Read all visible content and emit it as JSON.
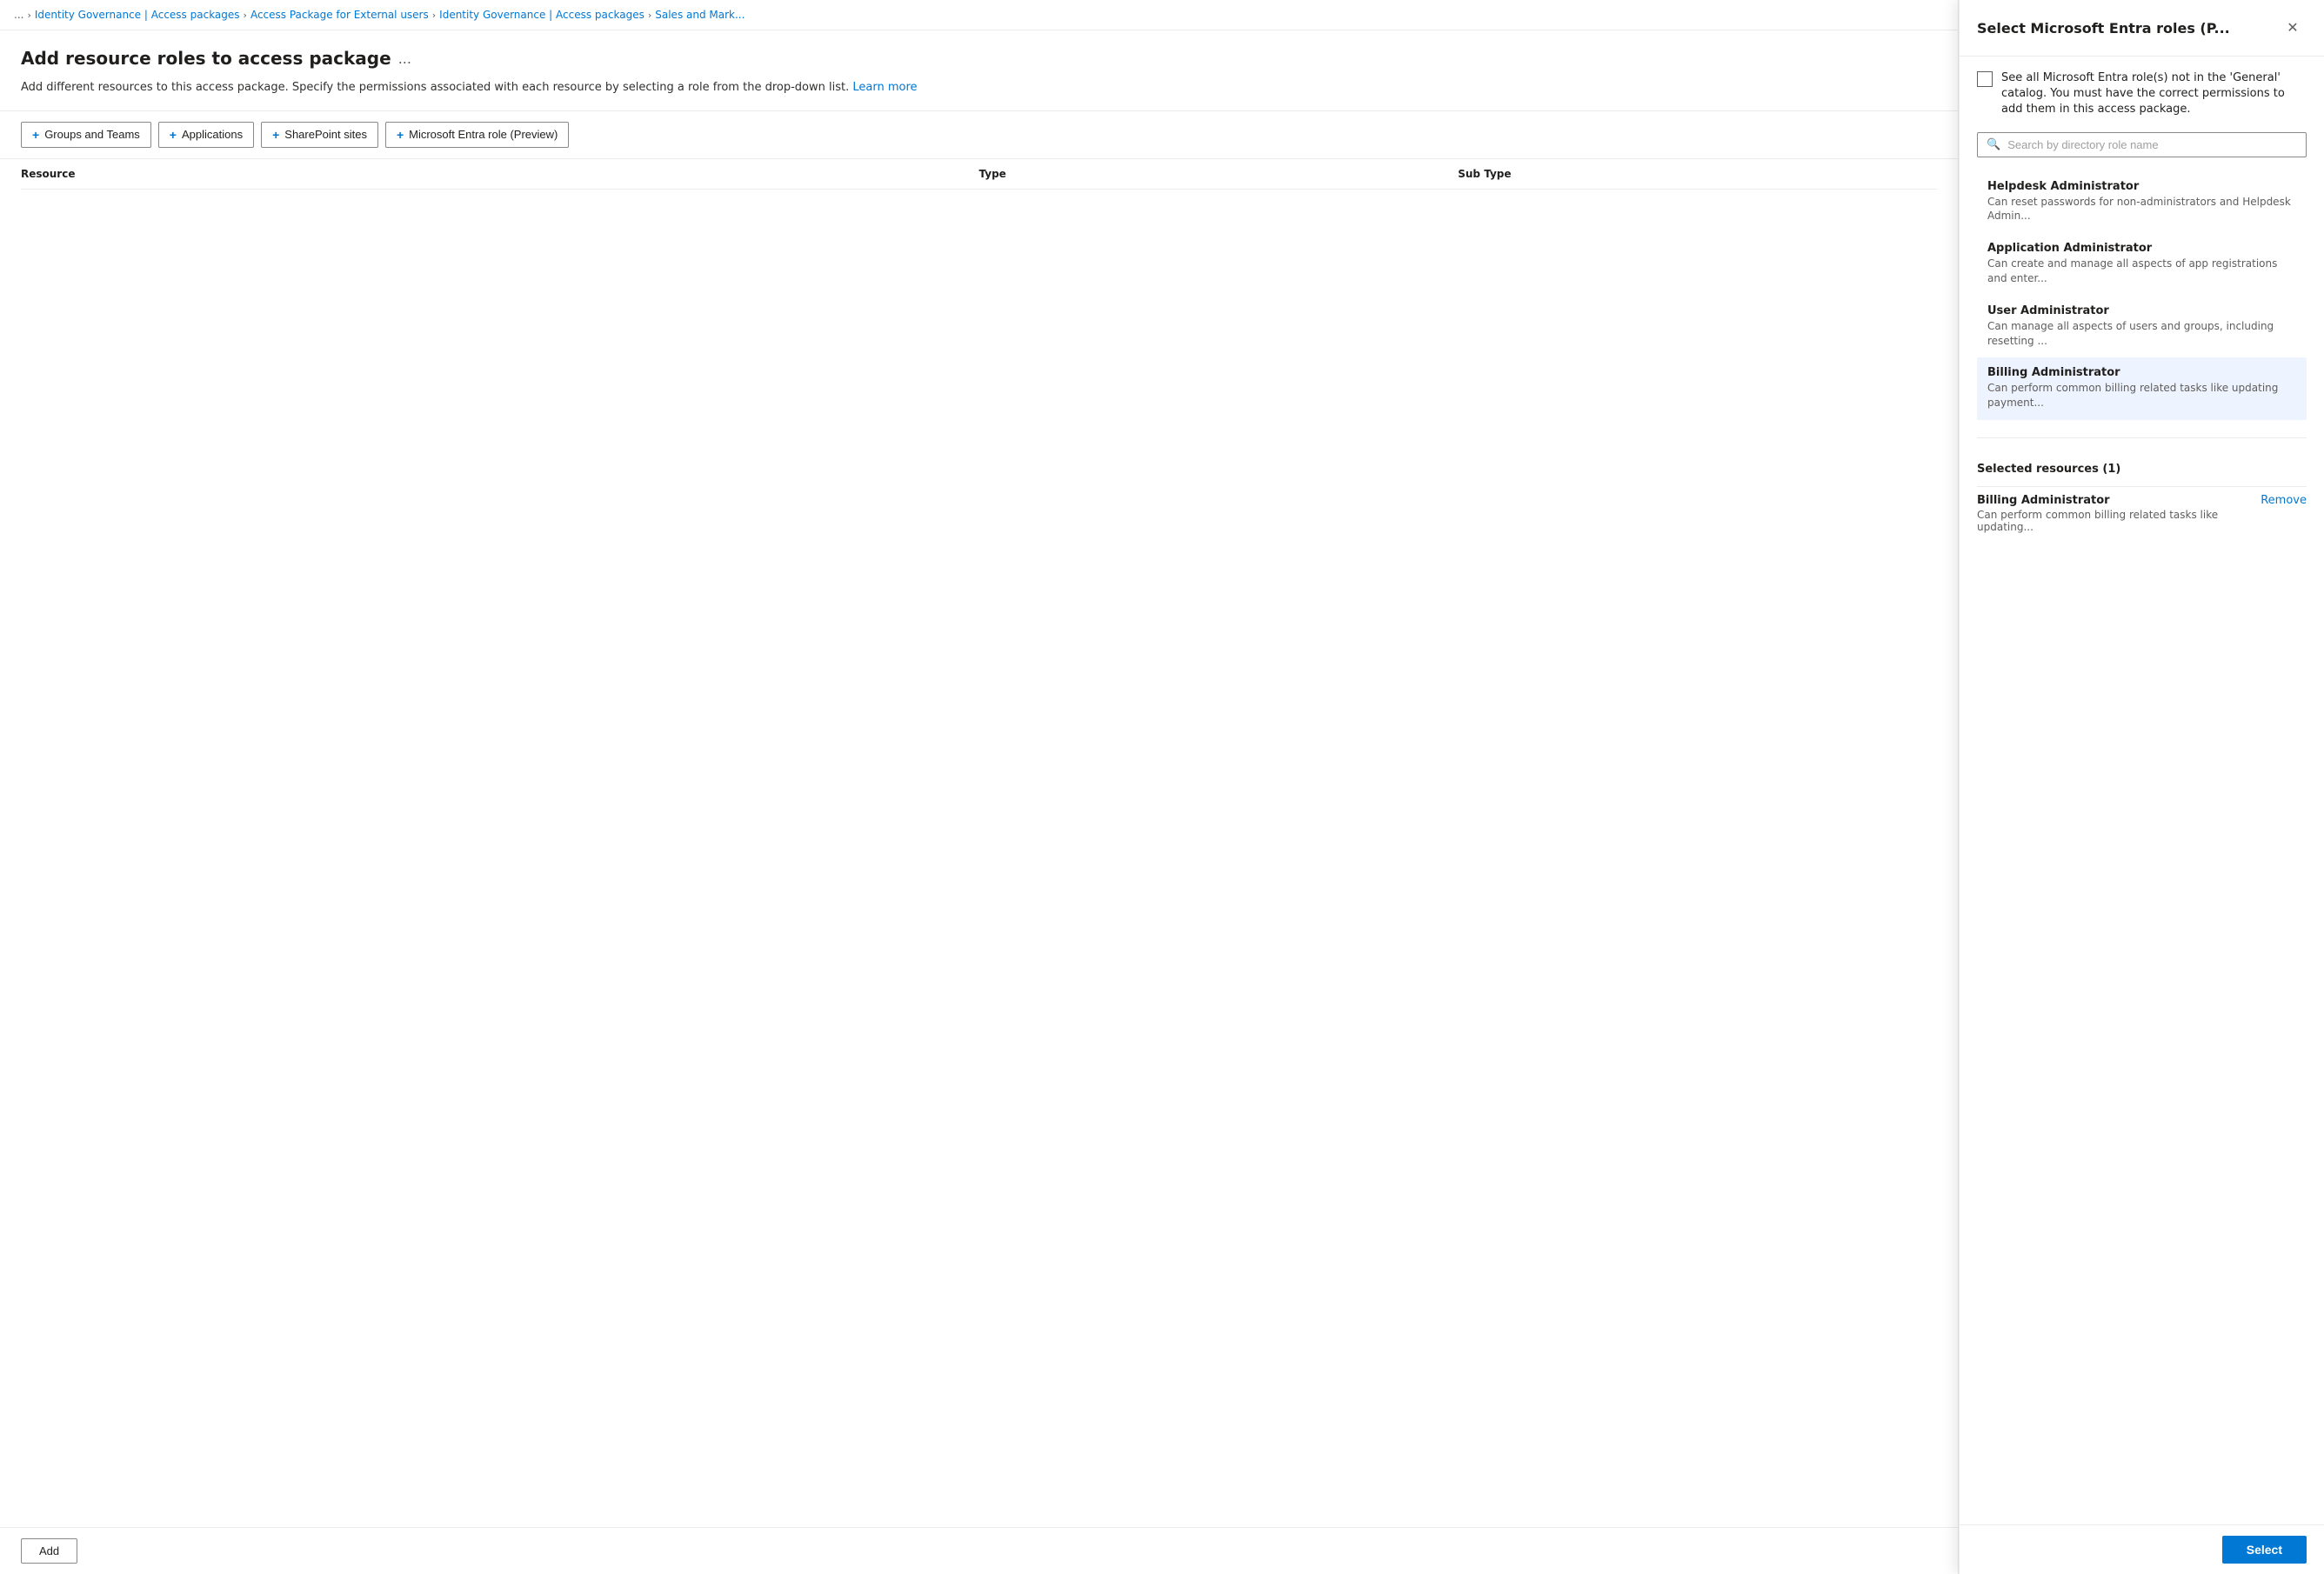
{
  "breadcrumb": {
    "dots": "...",
    "items": [
      {
        "label": "Identity Governance | Access packages"
      },
      {
        "label": "Access Package for External users"
      },
      {
        "label": "Identity Governance | Access packages"
      },
      {
        "label": "Sales and Mark..."
      }
    ]
  },
  "page": {
    "title": "Add resource roles to access package",
    "title_more": "...",
    "description": "Add different resources to this access package. Specify the permissions associated with each resource by selecting a role from the drop-down list.",
    "learn_more": "Learn more"
  },
  "toolbar": {
    "buttons": [
      {
        "label": "Groups and Teams",
        "icon": "+"
      },
      {
        "label": "Applications",
        "icon": "+"
      },
      {
        "label": "SharePoint sites",
        "icon": "+"
      },
      {
        "label": "Microsoft Entra role (Preview)",
        "icon": "+"
      }
    ]
  },
  "table": {
    "columns": [
      "Resource",
      "Type",
      "Sub Type"
    ]
  },
  "bottom": {
    "add_label": "Add"
  },
  "side_panel": {
    "title": "Select Microsoft Entra roles (P...",
    "close_icon": "✕",
    "checkbox_label": "See all Microsoft Entra role(s) not in the 'General' catalog. You must have the correct permissions to add them in this access package.",
    "search_placeholder": "Search by directory role name",
    "roles": [
      {
        "name": "Helpdesk Administrator",
        "desc": "Can reset passwords for non-administrators and Helpdesk Admin...",
        "selected": false,
        "highlighted": false
      },
      {
        "name": "Application Administrator",
        "desc": "Can create and manage all aspects of app registrations and enter...",
        "selected": false,
        "highlighted": false
      },
      {
        "name": "User Administrator",
        "desc": "Can manage all aspects of users and groups, including resetting ...",
        "selected": false,
        "highlighted": false
      },
      {
        "name": "Billing Administrator",
        "desc": "Can perform common billing related tasks like updating payment...",
        "selected": true,
        "highlighted": true
      }
    ],
    "selected_resources_title": "Selected resources (1)",
    "selected_resources": [
      {
        "name": "Billing Administrator",
        "desc": "Can perform common billing related tasks like updating...",
        "remove_label": "Remove"
      }
    ],
    "select_button_label": "Select"
  }
}
